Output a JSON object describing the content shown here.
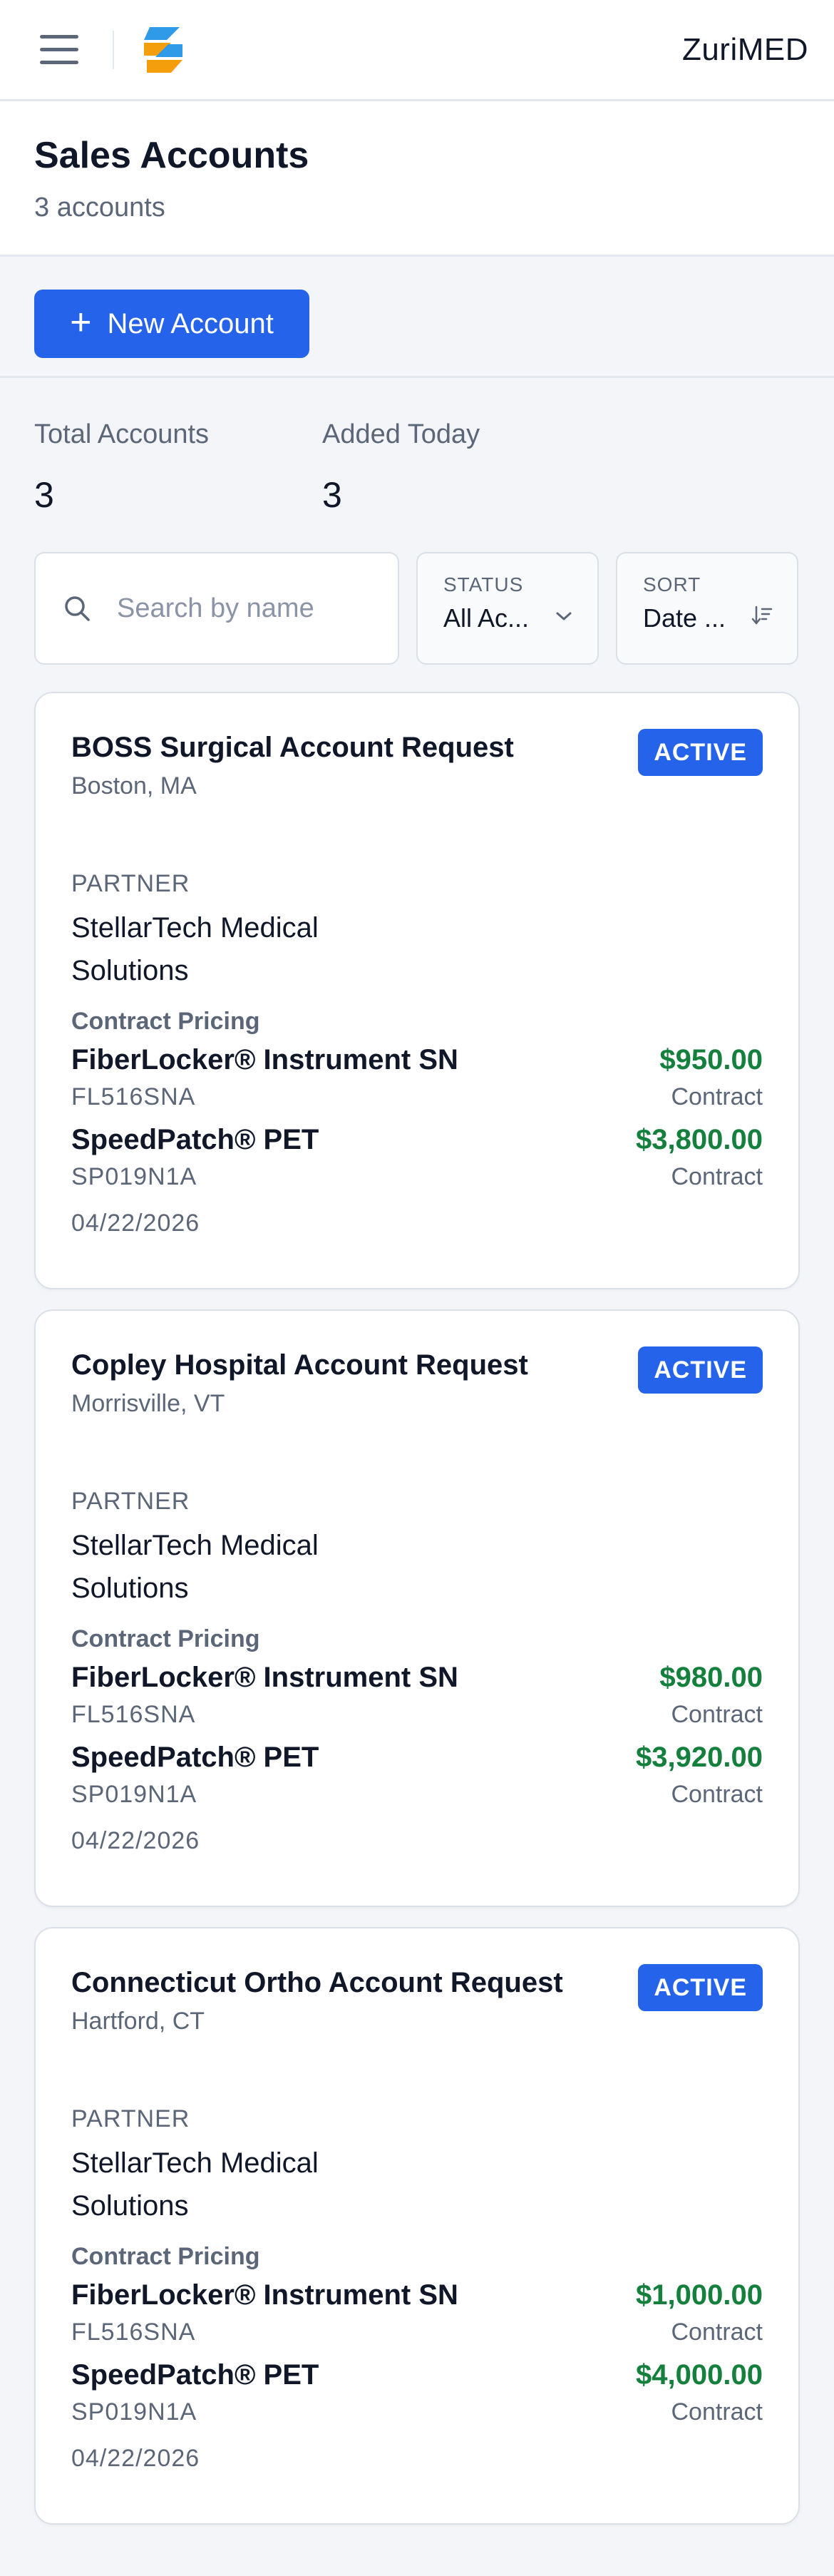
{
  "topbar": {
    "brand": "ZuriMED",
    "menu_icon": "hamburger-menu-icon",
    "logo_icon": "zurimed-logo",
    "accent": "#2563eb"
  },
  "header": {
    "title": "Sales Accounts",
    "subtitle": "3 accounts"
  },
  "actions": {
    "new_account_label": "New Account",
    "new_account_icon": "plus-icon"
  },
  "stats": [
    {
      "label": "Total Accounts",
      "value": "3"
    },
    {
      "label": "Added Today",
      "value": "3"
    }
  ],
  "filters": {
    "search_placeholder": "Search by name",
    "search_value": "",
    "status_label": "STATUS",
    "status_value": "All Ac...",
    "sort_label": "SORT",
    "sort_value": "Date ...",
    "sort_icon": "sort-descending-icon",
    "status_icon": "chevron-down-icon"
  },
  "colors": {
    "badge": "#2563eb",
    "price": "#15803d",
    "muted": "#5b6678"
  },
  "accounts": [
    {
      "title": "BOSS Surgical Account Request",
      "location": "Boston, MA",
      "status": "ACTIVE",
      "partner_label": "PARTNER",
      "partner": "StellarTech Medical Solutions",
      "pricing_label": "Contract Pricing",
      "products": [
        {
          "name": "FiberLocker® Instrument SN",
          "sku": "FL516SNA",
          "price": "$950.00",
          "type": "Contract"
        },
        {
          "name": "SpeedPatch® PET",
          "sku": "SP019N1A",
          "price": "$3,800.00",
          "type": "Contract"
        }
      ],
      "date": "04/22/2026"
    },
    {
      "title": "Copley Hospital Account Request",
      "location": "Morrisville, VT",
      "status": "ACTIVE",
      "partner_label": "PARTNER",
      "partner": "StellarTech Medical Solutions",
      "pricing_label": "Contract Pricing",
      "products": [
        {
          "name": "FiberLocker® Instrument SN",
          "sku": "FL516SNA",
          "price": "$980.00",
          "type": "Contract"
        },
        {
          "name": "SpeedPatch® PET",
          "sku": "SP019N1A",
          "price": "$3,920.00",
          "type": "Contract"
        }
      ],
      "date": "04/22/2026"
    },
    {
      "title": "Connecticut Ortho Account Request",
      "location": "Hartford, CT",
      "status": "ACTIVE",
      "partner_label": "PARTNER",
      "partner": "StellarTech Medical Solutions",
      "pricing_label": "Contract Pricing",
      "products": [
        {
          "name": "FiberLocker® Instrument SN",
          "sku": "FL516SNA",
          "price": "$1,000.00",
          "type": "Contract"
        },
        {
          "name": "SpeedPatch® PET",
          "sku": "SP019N1A",
          "price": "$4,000.00",
          "type": "Contract"
        }
      ],
      "date": "04/22/2026"
    }
  ]
}
